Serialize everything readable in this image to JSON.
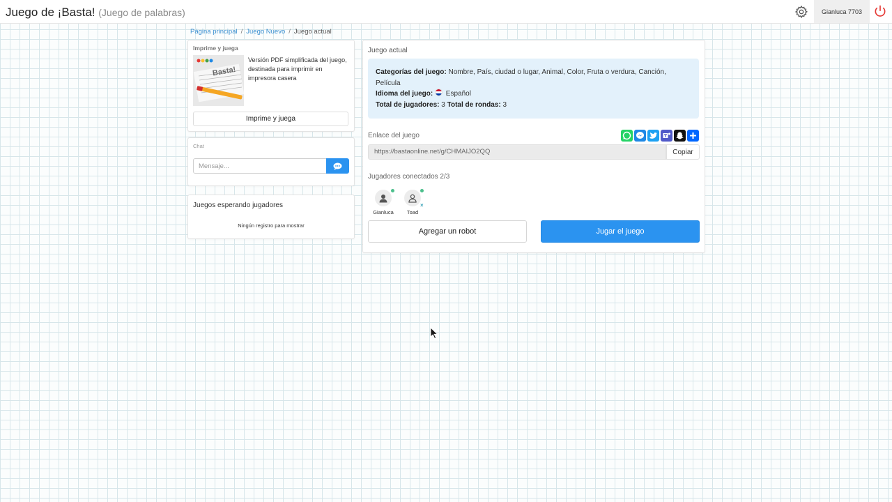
{
  "header": {
    "title": "Juego de ¡Basta!",
    "subtitle": "(Juego de palabras)",
    "user": "Gianluca 7703",
    "settings_icon": "gear-icon",
    "logout_icon": "power-icon",
    "logout_color": "#e53935"
  },
  "breadcrumb": {
    "home": "Página principal",
    "new_game": "Juego Nuevo",
    "current": "Juego actual"
  },
  "print_card": {
    "title": "Imprime y juega",
    "description": "Versión PDF simplificada del juego, destinada para imprimir en impresora casera",
    "thumb_text": "Basta!",
    "button": "Imprime y juega"
  },
  "chat": {
    "title": "Chat",
    "placeholder": "Mensaje...",
    "send_icon": "message-icon"
  },
  "waiting_games": {
    "title": "Juegos esperando jugadores",
    "empty": "Ningún registro para mostrar"
  },
  "current_game": {
    "title": "Juego actual",
    "categories_label": "Categorías del juego:",
    "categories": "Nombre, País, ciudad o lugar, Animal, Color, Fruta o verdura, Canción, Película",
    "language_label": "Idioma del juego:",
    "language": "Español",
    "players_label": "Total de jugadores:",
    "players": "3",
    "rounds_label": "Total de rondas:",
    "rounds": "3",
    "link_label": "Enlace del juego",
    "link": "https://bastaonline.net/g/CHMAIJO2QQ",
    "copy": "Copiar",
    "share_icons": [
      "whatsapp-icon",
      "messenger-icon",
      "twitter-icon",
      "teams-icon",
      "snapchat-icon",
      "share-plus-icon"
    ],
    "connected_label": "Jugadores conectados 2/3",
    "players_list": [
      {
        "name": "Gianluca",
        "online": true
      },
      {
        "name": "Toad",
        "online": true,
        "removable": true
      }
    ],
    "remove_symbol": "×",
    "add_robot": "Agregar un robot",
    "play": "Jugar el juego",
    "accent": "#2b93f0"
  }
}
